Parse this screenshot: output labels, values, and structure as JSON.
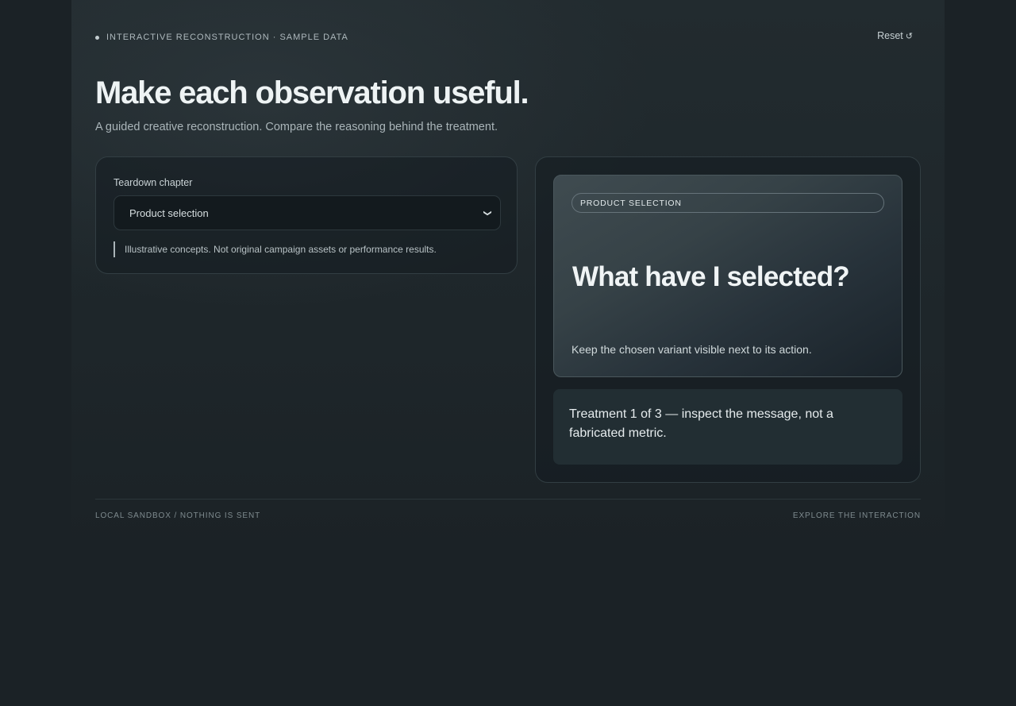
{
  "header": {
    "eyebrow": "INTERACTIVE RECONSTRUCTION · SAMPLE DATA",
    "reset_label": "Reset",
    "reset_icon": "↺"
  },
  "main": {
    "title": "Make each observation useful.",
    "subtitle": "A guided creative reconstruction. Compare the reasoning behind the treatment."
  },
  "controls": {
    "chapter_label": "Teardown chapter",
    "chapter_selected": "Product selection",
    "note": "Illustrative concepts. Not original campaign assets or performance results."
  },
  "preview": {
    "tag": "PRODUCT SELECTION",
    "headline": "What have I selected?",
    "caption": "Keep the chosen variant visible next to its action.",
    "treatment_text": "Treatment 1 of 3 — inspect the message, not a fabricated metric."
  },
  "footer": {
    "left": "LOCAL SANDBOX / NOTHING IS SENT",
    "right": "EXPLORE THE INTERACTION"
  }
}
